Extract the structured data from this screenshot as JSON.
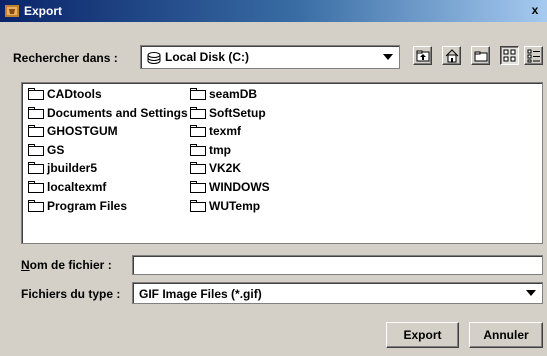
{
  "window": {
    "title": "Export",
    "close_glyph": "x"
  },
  "look_in": {
    "label": "Rechercher dans :",
    "value": "Local Disk (C:)",
    "drive_icon": "disk-drive-icon"
  },
  "toolbar": {
    "buttons": [
      {
        "name": "up-one-level",
        "icon": "folder-up-icon"
      },
      {
        "name": "home",
        "icon": "home-icon"
      },
      {
        "name": "new-folder",
        "icon": "new-folder-icon"
      },
      {
        "name": "list-view",
        "icon": "list-view-icon",
        "pressed": true
      },
      {
        "name": "details-view",
        "icon": "details-view-icon"
      }
    ]
  },
  "files": [
    "CADtools",
    "Documents and Settings",
    "GHOSTGUM",
    "GS",
    "jbuilder5",
    "localtexmf",
    "Program Files",
    "seamDB",
    "SoftSetup",
    "texmf",
    "tmp",
    "VK2K",
    "WINDOWS",
    "WUTemp"
  ],
  "file_name": {
    "label": "Nom de fichier :",
    "mnemonic": "N",
    "label_rest": "om de fichier :",
    "value": ""
  },
  "file_type": {
    "label": "Fichiers du type :",
    "value": "GIF Image Files (*.gif)"
  },
  "buttons": {
    "export": "Export",
    "cancel": "Annuler"
  },
  "colors": {
    "title_start": "#0a246a",
    "title_end": "#a6caf0",
    "dialog_bg": "#d4d0c8"
  }
}
